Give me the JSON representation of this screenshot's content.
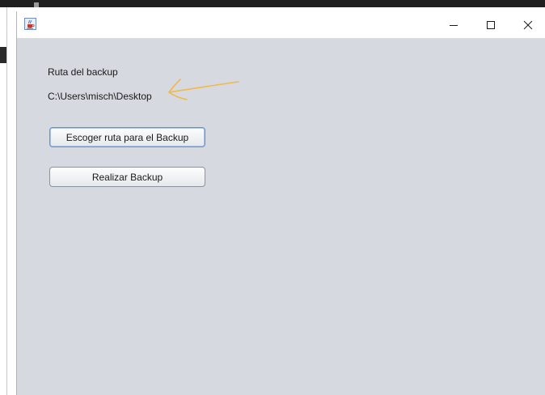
{
  "window": {
    "icon": "java-coffee-cup-icon",
    "controls": {
      "minimize_icon": "minimize-icon",
      "maximize_icon": "maximize-icon",
      "close_icon": "close-icon"
    }
  },
  "content": {
    "title_label": "Ruta del backup",
    "path_value": "C:\\Users\\misch\\Desktop",
    "choose_path_button": "Escoger ruta para el Backup",
    "do_backup_button": "Realizar Backup",
    "annotation_arrow_color": "#f2b84b",
    "background_color": "#d6d9e0"
  }
}
